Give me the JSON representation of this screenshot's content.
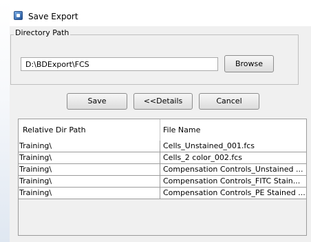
{
  "window": {
    "title": "Save Export",
    "icon": "app-icon"
  },
  "directory": {
    "legend": "Directory Path",
    "path_value": "D:\\BDExport\\FCS",
    "browse_label": "Browse"
  },
  "actions": {
    "save_label": "Save",
    "details_label": "<<Details",
    "cancel_label": "Cancel"
  },
  "table": {
    "headers": [
      "Relative Dir Path",
      "File Name"
    ],
    "rows": [
      {
        "dir": "Training\\",
        "file": "Cells_Unstained_001.fcs"
      },
      {
        "dir": "Training\\",
        "file": "Cells_2 color_002.fcs"
      },
      {
        "dir": "Training\\",
        "file": "Compensation Controls_Unstained ..."
      },
      {
        "dir": "Training\\",
        "file": "Compensation Controls_FITC Stain..."
      },
      {
        "dir": "Training\\",
        "file": "Compensation Controls_PE Stained ..."
      }
    ]
  }
}
